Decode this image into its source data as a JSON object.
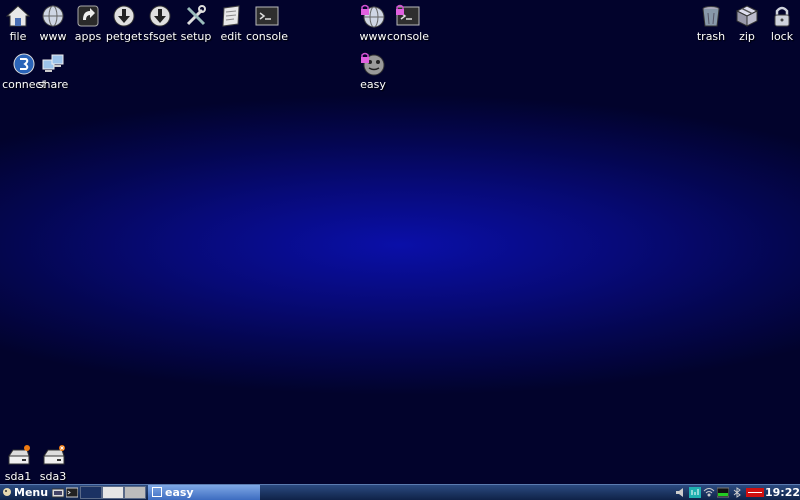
{
  "desktop": {
    "icons_top": [
      {
        "label": "file",
        "icon": "home-icon"
      },
      {
        "label": "www",
        "icon": "globe-icon"
      },
      {
        "label": "apps",
        "icon": "apps-icon"
      },
      {
        "label": "petget",
        "icon": "download-icon"
      },
      {
        "label": "sfsget",
        "icon": "download-icon"
      },
      {
        "label": "setup",
        "icon": "tools-icon"
      },
      {
        "label": "edit",
        "icon": "edit-icon"
      },
      {
        "label": "console",
        "icon": "terminal-icon"
      }
    ],
    "icons_second": [
      {
        "label": "connect",
        "icon": "connect-icon"
      },
      {
        "label": "share",
        "icon": "share-icon"
      }
    ],
    "icons_center": [
      {
        "label": "www",
        "icon": "globe-lock-icon"
      },
      {
        "label": "console",
        "icon": "terminal-lock-icon"
      },
      {
        "label": "easy",
        "icon": "easy-icon"
      }
    ],
    "icons_right": [
      {
        "label": "trash",
        "icon": "trash-icon"
      },
      {
        "label": "zip",
        "icon": "zip-icon"
      },
      {
        "label": "lock",
        "icon": "lock-icon"
      }
    ],
    "drives": [
      {
        "label": "sda1",
        "icon": "drive-icon",
        "status": "mounted"
      },
      {
        "label": "sda3",
        "icon": "drive-icon",
        "status": "unmounted"
      }
    ]
  },
  "taskbar": {
    "menu_label": "Menu",
    "active_task": "easy",
    "clock": "19:22",
    "colors": {
      "bar": "#0f2248",
      "task": "#3d6cc0",
      "battery": "#d01010",
      "net": "#20b0b0"
    }
  }
}
